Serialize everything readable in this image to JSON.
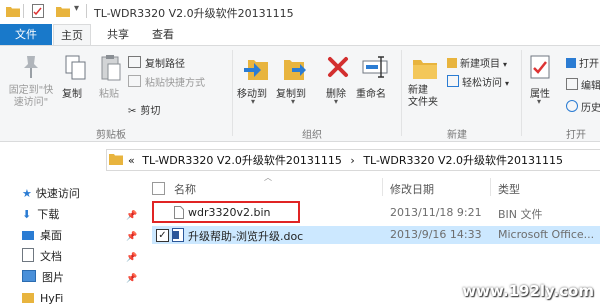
{
  "window": {
    "title": "TL-WDR3320 V2.0升级软件20131115"
  },
  "tabs": {
    "file": "文件",
    "home": "主页",
    "share": "共享",
    "view": "查看"
  },
  "ribbon": {
    "pin_label": "固定到\"快\n速访问\"",
    "copy_label": "复制",
    "paste_label": "粘贴",
    "copy_path": "复制路径",
    "paste_shortcut": "粘贴快捷方式",
    "cut": "剪切",
    "move_to": "移动到",
    "copy_to": "复制到",
    "delete": "删除",
    "rename": "重命名",
    "new_folder": "新建\n文件夹",
    "new_item": "新建项目",
    "easy_access": "轻松访问",
    "properties": "属性",
    "open": "打开",
    "edit": "编辑",
    "history": "历史",
    "group_clipboard": "剪贴板",
    "group_organize": "组织",
    "group_new": "新建",
    "group_open": "打开"
  },
  "address": {
    "chevron": "«",
    "segment1": "TL-WDR3320 V2.0升级软件20131115",
    "separator": "›",
    "segment2": "TL-WDR3320 V2.0升级软件20131115"
  },
  "columns": {
    "name": "名称",
    "date": "修改日期",
    "type": "类型"
  },
  "nav": {
    "quick_access": "快速访问",
    "items": [
      {
        "label": "下载"
      },
      {
        "label": "桌面"
      },
      {
        "label": "文档"
      },
      {
        "label": "图片"
      },
      {
        "label": "HyFi"
      }
    ]
  },
  "files": [
    {
      "name": "wdr3320v2.bin",
      "date": "2013/11/18 9:21",
      "type": "BIN 文件"
    },
    {
      "name": "升级帮助-浏览升级.doc",
      "date": "2013/9/16 14:33",
      "type": "Microsoft Office..."
    }
  ],
  "watermark": "www.192ly.com",
  "colors": {
    "accent": "#1979ca",
    "folder": "#e8b43e",
    "highlight_box": "#e02424",
    "selected_row": "#cce8ff"
  }
}
